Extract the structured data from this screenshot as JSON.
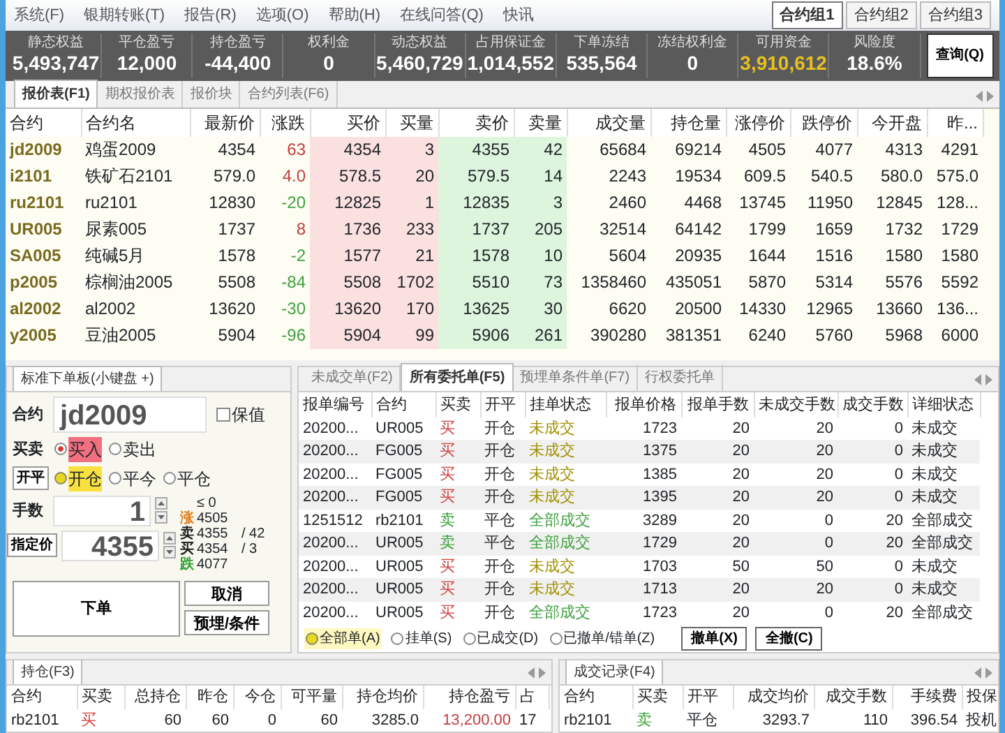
{
  "menu": [
    "系统(F)",
    "银期转账(T)",
    "报告(R)",
    "选项(O)",
    "帮助(H)",
    "在线问答(Q)",
    "快讯"
  ],
  "contract_groups": [
    {
      "label": "合约组1",
      "selected": true
    },
    {
      "label": "合约组2",
      "selected": false
    },
    {
      "label": "合约组3",
      "selected": false
    }
  ],
  "account": [
    {
      "label": "静态权益",
      "value": "5,493,747",
      "highlighted": false
    },
    {
      "label": "平仓盈亏",
      "value": "12,000",
      "highlighted": false
    },
    {
      "label": "持仓盈亏",
      "value": "-44,400",
      "highlighted": false
    },
    {
      "label": "权利金",
      "value": "0",
      "highlighted": false
    },
    {
      "label": "动态权益",
      "value": "5,460,729",
      "highlighted": false
    },
    {
      "label": "占用保证金",
      "value": "1,014,552",
      "highlighted": false
    },
    {
      "label": "下单冻结",
      "value": "535,564",
      "highlighted": false
    },
    {
      "label": "冻结权利金",
      "value": "0",
      "highlighted": false
    },
    {
      "label": "可用资金",
      "value": "3,910,612",
      "highlighted": true
    },
    {
      "label": "风险度",
      "value": "18.6%",
      "highlighted": false
    }
  ],
  "query_button": "查询(Q)",
  "quote_tabs": [
    {
      "label": "报价表(F1)",
      "selected": true
    },
    {
      "label": "期权报价表",
      "selected": false
    },
    {
      "label": "报价块",
      "selected": false
    },
    {
      "label": "合约列表(F6)",
      "selected": false
    }
  ],
  "quotes": {
    "columns": [
      "合约",
      "合约名",
      "最新价",
      "涨跌",
      "买价",
      "买量",
      "卖价",
      "卖量",
      "成交量",
      "持仓量",
      "涨停价",
      "跌停价",
      "今开盘",
      "昨..."
    ],
    "rows": [
      {
        "color": "#c04040",
        "cells": [
          "jd2009",
          "鸡蛋2009",
          "4354",
          "63",
          "4354",
          "3",
          "4355",
          "42",
          "65684",
          "69214",
          "4505",
          "4077",
          "4313",
          "4291"
        ]
      },
      {
        "color": "#c04040",
        "cells": [
          "i2101",
          "铁矿石2101",
          "579.0",
          "4.0",
          "578.5",
          "20",
          "579.5",
          "14",
          "2243",
          "19534",
          "609.5",
          "540.5",
          "580.0",
          "575.0"
        ]
      },
      {
        "color": "#40a040",
        "cells": [
          "ru2101",
          "ru2101",
          "12830",
          "-20",
          "12825",
          "1",
          "12835",
          "3",
          "2460",
          "4468",
          "13745",
          "11950",
          "12845",
          "128..."
        ]
      },
      {
        "color": "#c04040",
        "cells": [
          "UR005",
          "尿素005",
          "1737",
          "8",
          "1736",
          "233",
          "1737",
          "205",
          "32514",
          "64142",
          "1799",
          "1659",
          "1732",
          "1729"
        ]
      },
      {
        "color": "#40a040",
        "cells": [
          "SA005",
          "纯碱5月",
          "1578",
          "-2",
          "1577",
          "21",
          "1578",
          "10",
          "5604",
          "20935",
          "1644",
          "1516",
          "1580",
          "1580"
        ]
      },
      {
        "color": "#40a040",
        "cells": [
          "p2005",
          "棕榈油2005",
          "5508",
          "-84",
          "5508",
          "1702",
          "5510",
          "73",
          "1358460",
          "435051",
          "5870",
          "5314",
          "5576",
          "5592"
        ]
      },
      {
        "color": "#40a040",
        "cells": [
          "al2002",
          "al2002",
          "13620",
          "-30",
          "13620",
          "170",
          "13625",
          "30",
          "6620",
          "20500",
          "14330",
          "12965",
          "13660",
          "136..."
        ]
      },
      {
        "color": "#40a040",
        "cells": [
          "y2005",
          "豆油2005",
          "5904",
          "-96",
          "5904",
          "99",
          "5906",
          "261",
          "390280",
          "381351",
          "6240",
          "5760",
          "5968",
          "6000"
        ]
      }
    ]
  },
  "order_panel": {
    "tab": "标准下单板(小键盘 +)",
    "contract_label": "合约",
    "contract": "jd2009",
    "hedge": {
      "label": "保值",
      "checked": false
    },
    "side_label": "买卖",
    "side_options": [
      {
        "label": "买入",
        "selected": true
      },
      {
        "label": "卖出",
        "selected": false
      }
    ],
    "offset_button": "开平",
    "offset_options": [
      {
        "label": "开仓",
        "selected": true
      },
      {
        "label": "平今",
        "selected": false
      },
      {
        "label": "平仓",
        "selected": false
      }
    ],
    "qty_label": "手数",
    "qty": "1",
    "limit": "≤ 0",
    "price_button": "指定价",
    "price": "4355",
    "ladder": [
      {
        "kind": "limit_up",
        "mark": "涨",
        "price": "4505"
      },
      {
        "kind": "ask",
        "mark": "卖",
        "price": "4355",
        "qty": "/ 42"
      },
      {
        "kind": "bid",
        "mark": "买",
        "price": "4354",
        "qty": "/ 3"
      },
      {
        "kind": "limit_down",
        "mark": "跌",
        "price": "4077"
      }
    ],
    "submit_button": "下单",
    "cancel_button": "取消",
    "preset_button": "预埋/条件"
  },
  "orders": {
    "tabs": [
      {
        "label": "未成交单(F2)",
        "selected": false
      },
      {
        "label": "所有委托单(F5)",
        "selected": true
      },
      {
        "label": "预埋单条件单(F7)",
        "selected": false
      },
      {
        "label": "行权委托单",
        "selected": false
      }
    ],
    "columns": [
      "报单编号",
      "合约",
      "买卖",
      "开平",
      "挂单状态",
      "报单价格",
      "报单手数",
      "未成交手数",
      "成交手数",
      "详细状态"
    ],
    "rows": [
      {
        "color": "#d04040",
        "filled": false,
        "cells": [
          "20200...",
          "UR005",
          "买",
          "开仓",
          "未成交",
          "1723",
          "20",
          "20",
          "0",
          "未成交"
        ]
      },
      {
        "color": "#d04040",
        "filled": false,
        "cells": [
          "20200...",
          "FG005",
          "买",
          "开仓",
          "未成交",
          "1375",
          "20",
          "20",
          "0",
          "未成交"
        ]
      },
      {
        "color": "#d04040",
        "filled": false,
        "cells": [
          "20200...",
          "FG005",
          "买",
          "开仓",
          "未成交",
          "1385",
          "20",
          "20",
          "0",
          "未成交"
        ]
      },
      {
        "color": "#d04040",
        "filled": false,
        "cells": [
          "20200...",
          "FG005",
          "买",
          "开仓",
          "未成交",
          "1395",
          "20",
          "20",
          "0",
          "未成交"
        ]
      },
      {
        "color": "#30a030",
        "filled": true,
        "cells": [
          "1251512",
          "rb2101",
          "卖",
          "平仓",
          "全部成交",
          "3289",
          "20",
          "0",
          "20",
          "全部成交"
        ]
      },
      {
        "color": "#30a030",
        "filled": true,
        "cells": [
          "20200...",
          "UR005",
          "卖",
          "平仓",
          "全部成交",
          "1729",
          "20",
          "0",
          "20",
          "全部成交"
        ]
      },
      {
        "color": "#d04040",
        "filled": false,
        "cells": [
          "20200...",
          "UR005",
          "买",
          "开仓",
          "未成交",
          "1703",
          "50",
          "50",
          "0",
          "未成交"
        ]
      },
      {
        "color": "#d04040",
        "filled": false,
        "cells": [
          "20200...",
          "UR005",
          "买",
          "开仓",
          "未成交",
          "1713",
          "20",
          "20",
          "0",
          "未成交"
        ]
      },
      {
        "color": "#d04040",
        "filled": true,
        "cells": [
          "20200...",
          "UR005",
          "买",
          "开仓",
          "全部成交",
          "1723",
          "20",
          "0",
          "20",
          "全部成交"
        ]
      }
    ],
    "filters": [
      {
        "label": "全部单(A)",
        "selected": true
      },
      {
        "label": "挂单(S)",
        "selected": false
      },
      {
        "label": "已成交(D)",
        "selected": false
      },
      {
        "label": "已撤单/错单(Z)",
        "selected": false
      }
    ],
    "cancel_button": "撤单(X)",
    "cancel_all_button": "全撤(C)"
  },
  "positions": {
    "tab": "持仓(F3)",
    "columns": [
      "合约",
      "买卖",
      "总持仓",
      "昨仓",
      "今仓",
      "可平量",
      "持仓均价",
      "持仓盈亏",
      "占"
    ],
    "rows": [
      {
        "color": "#d04040",
        "profit": true,
        "cells": [
          "rb2101",
          "买",
          "60",
          "60",
          "0",
          "60",
          "3285.0",
          "13,200.00",
          "17"
        ]
      }
    ]
  },
  "trades": {
    "tab": "成交记录(F4)",
    "columns": [
      "合约",
      "买卖",
      "开平",
      "成交均价",
      "成交手数",
      "手续费",
      "投保"
    ],
    "rows": [
      {
        "color": "#30a030",
        "cells": [
          "rb2101",
          "卖",
          "平仓",
          "3293.7",
          "110",
          "396.54",
          "投机"
        ]
      }
    ]
  }
}
